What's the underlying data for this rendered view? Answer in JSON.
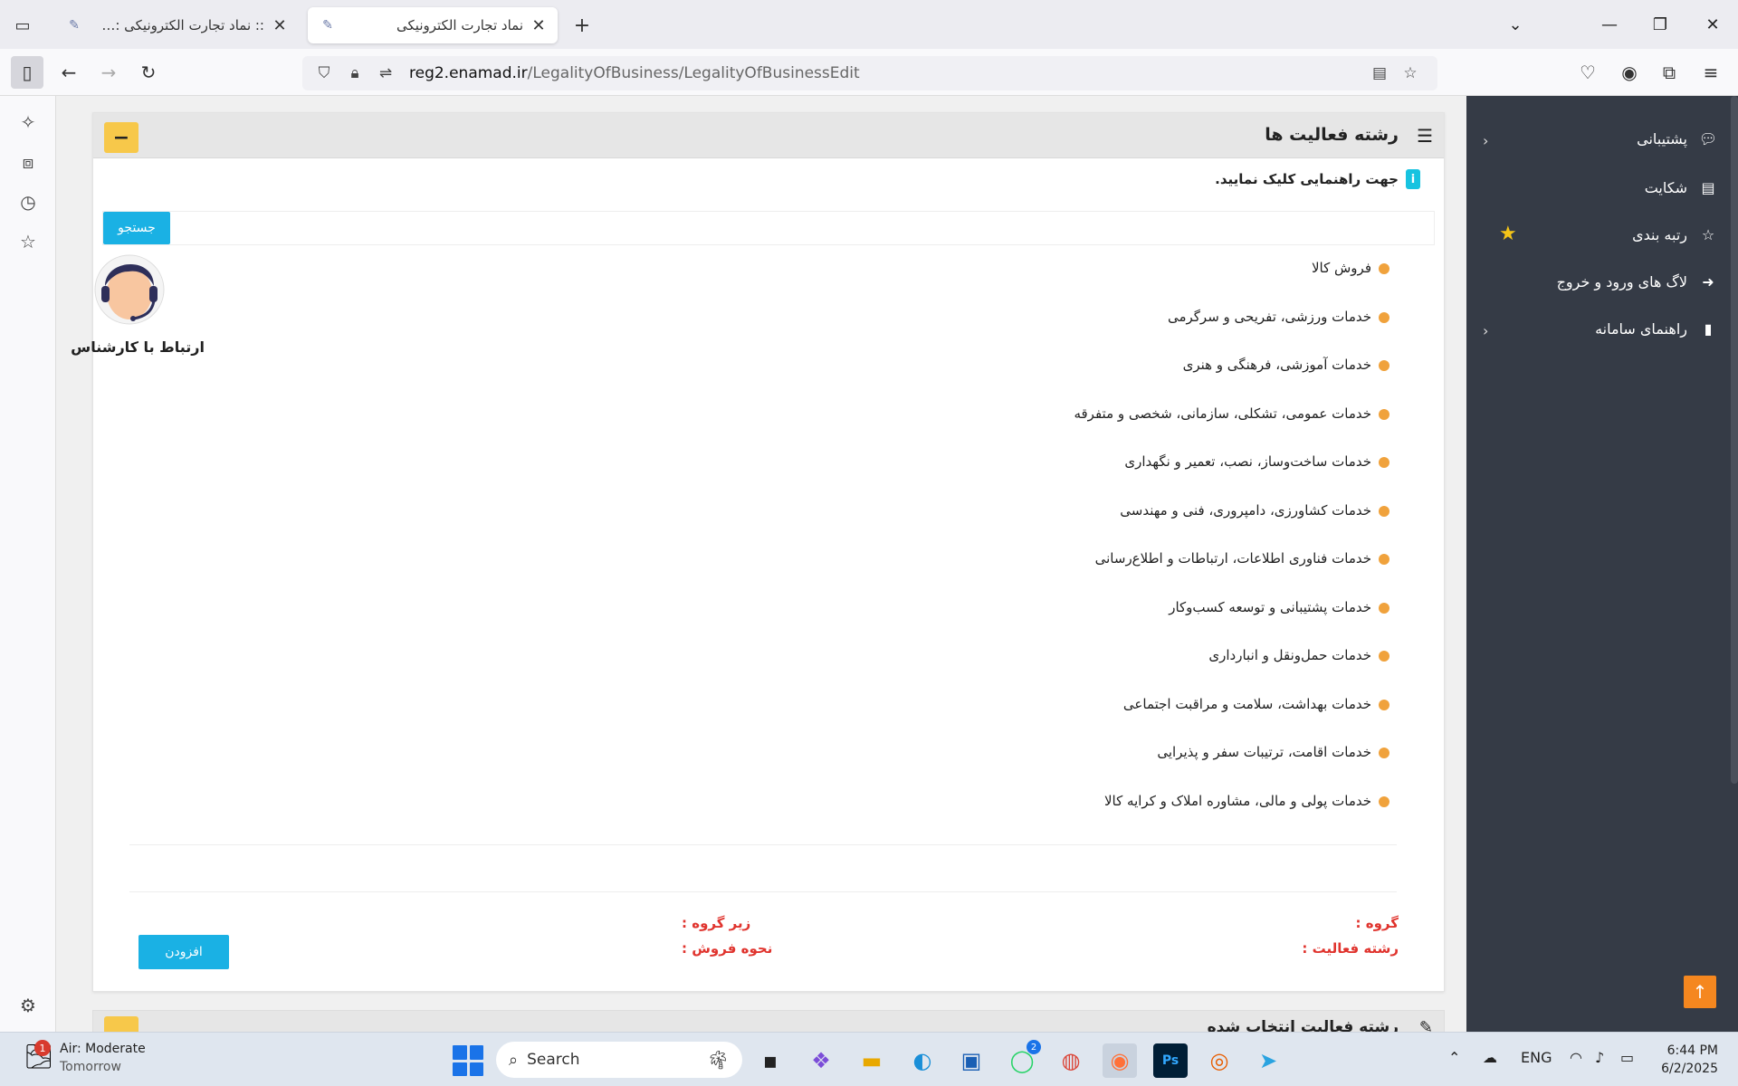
{
  "browser": {
    "tabs": [
      {
        "title": ":: نماد تجارت الکترونیکی :: انتخاب",
        "active": false
      },
      {
        "title": "نماد تجارت الکترونیکی",
        "active": true
      }
    ],
    "new_tab": "+",
    "url_host": "reg2.enamad.ir",
    "url_path": "/LegalityOfBusiness/LegalityOfBusinessEdit"
  },
  "panel": {
    "title": "رشته فعالیت ها",
    "collapse_label": "−",
    "help_text": "جهت راهنمایی کلیک نمایید.",
    "help_icon": "i",
    "search_label": "جستجو",
    "activities": [
      "فروش کالا",
      "خدمات ورزشی، تفریحی و سرگرمی",
      "خدمات آموزشی، فرهنگی و هنری",
      "خدمات عمومی، تشکلی، سازمانی، شخصی و متفرقه",
      "خدمات ساخت‌وساز، نصب، تعمیر و نگهداری",
      "خدمات کشاورزی، دامپروری، فنی و مهندسی",
      "خدمات فناوری اطلاعات، ارتباطات و اطلاع‌رسانی",
      "خدمات پشتیبانی و توسعه کسب‌وکار",
      "خدمات حمل‌ونقل و انبارداری",
      "خدمات بهداشت، سلامت و مراقبت اجتماعی",
      "خدمات اقامت، ترتیبات سفر و پذیرایی",
      "خدمات پولی و مالی، مشاوره املاک و کرایه کالا"
    ],
    "form": {
      "group_label": "گروه :",
      "subgroup_label": "زیر گروه :",
      "activity_label": "رشته فعالیت :",
      "sale_method_label": "نحوه فروش :",
      "add_button": "افزودن"
    },
    "next_panel_title": "رشته فعالیت انتخاب شده"
  },
  "expert": {
    "label": "ارتباط با کارشناس"
  },
  "site_sidebar": {
    "items": [
      {
        "label": "پشتیبانی",
        "icon": "chat-icon",
        "chevron": true
      },
      {
        "label": "شکایت",
        "icon": "document-icon",
        "chevron": false
      },
      {
        "label": "رتبه بندی",
        "icon": "star-icon",
        "chevron": false
      },
      {
        "label": "لاگ های ورود و خروج",
        "icon": "login-icon",
        "chevron": false
      },
      {
        "label": "راهنمای سامانه",
        "icon": "file-icon",
        "chevron": true
      }
    ]
  },
  "taskbar": {
    "weather_title": "Air: Moderate",
    "weather_sub": "Tomorrow",
    "weather_badge": "1",
    "search_placeholder": "Search",
    "lang": "ENG",
    "time": "6:44 PM",
    "date": "6/2/2025",
    "whatsapp_badge": "2"
  },
  "colors": {
    "accent_blue": "#1ab1e4",
    "accent_yellow": "#f7c84a",
    "bullet_orange": "#f0a23c",
    "form_label_red": "#e0342e",
    "sidebar_dark": "#353b46"
  }
}
